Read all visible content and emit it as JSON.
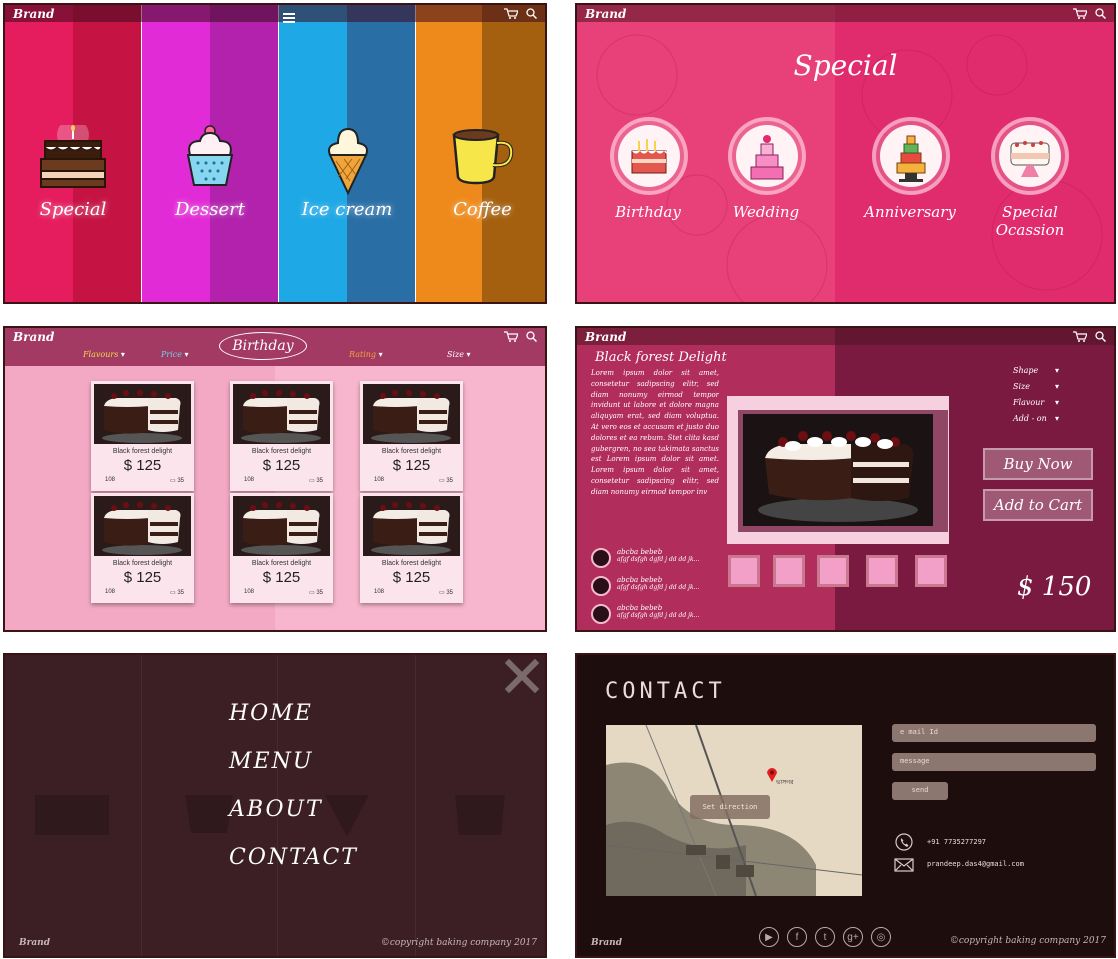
{
  "colors": {
    "special": "#d8174f",
    "dessert": "#c227bb",
    "icecream": "#2a9ad6",
    "coffee": "#e17c12",
    "special_bg": "#de3574",
    "birthday_bg": "#f3a9c4",
    "detail_bg": "#b02d5c",
    "menu_bg": "#3b1f24",
    "contact_bg": "#1e0d0d"
  },
  "brand": "Brand",
  "home": {
    "categories": [
      {
        "label": "Special",
        "icon": "cake-icon"
      },
      {
        "label": "Dessert",
        "icon": "cupcake-icon"
      },
      {
        "label": "Ice cream",
        "icon": "ice-cream-icon"
      },
      {
        "label": "Coffee",
        "icon": "coffee-cup-icon"
      }
    ]
  },
  "special": {
    "title": "Special",
    "occasions": [
      {
        "label": "Birthday",
        "icon": "birthday-cake-icon"
      },
      {
        "label": "Wedding",
        "icon": "wedding-cake-icon"
      },
      {
        "label": "Anniversary",
        "icon": "anniversary-cake-icon"
      },
      {
        "label": "Special",
        "label2": "Ocassion",
        "icon": "special-cake-icon"
      }
    ]
  },
  "birthday": {
    "title": "Birthday",
    "filters": [
      "Flavours",
      "Price",
      "Rating",
      "Size"
    ],
    "products": [
      {
        "name": "Black forest delight",
        "price": "$ 125",
        "likes": "108",
        "comments": "35"
      },
      {
        "name": "Black forest delight",
        "price": "$ 125",
        "likes": "108",
        "comments": "35"
      },
      {
        "name": "Black forest delight",
        "price": "$ 125",
        "likes": "108",
        "comments": "35"
      },
      {
        "name": "Black forest delight",
        "price": "$ 125",
        "likes": "108",
        "comments": "35"
      },
      {
        "name": "Black forest delight",
        "price": "$ 125",
        "likes": "108",
        "comments": "35"
      },
      {
        "name": "Black forest delight",
        "price": "$ 125",
        "likes": "108",
        "comments": "35"
      }
    ]
  },
  "detail": {
    "title": "Black forest Delight",
    "description": "Lorem ipsum dolor sit amet, consetetur sadipscing elitr, sed diam nonumy eirmod tempor invidunt ut labore et dolore magna aliquyam erat, sed diam voluptua. At vero eos et accusam et justo duo dolores et ea rebum. Stet clita kasd gubergren, no sea takimata sanctus est Lorem ipsum dolor sit amet. Lorem ipsum dolor sit amet, consetetur sadipscing elitr, sed diam nonumy eirmod tempor inv",
    "options": [
      "Shape",
      "Size",
      "Flavour",
      "Add - on"
    ],
    "buy_now": "Buy Now",
    "add_to_cart": "Add to Cart",
    "price": "$ 150",
    "reviews": [
      {
        "name": "abcba bebeb",
        "text": "afgf dsfgh dgfd j dd dd jk..."
      },
      {
        "name": "abcba bebeb",
        "text": "afgf dsfgh dgfd j dd dd jk..."
      },
      {
        "name": "abcba bebeb",
        "text": "afgf dsfgh dgfd j dd dd jk..."
      }
    ]
  },
  "menu": {
    "items": [
      "HOME",
      "MENU",
      "ABOUT",
      "CONTACT"
    ],
    "footer_brand": "Brand",
    "copyright": "©copyright baking company 2017"
  },
  "contact": {
    "title": "CONTACT",
    "email_placeholder": "e mail Id",
    "message_placeholder": "message",
    "send": "send",
    "phone": "+91 7735277297",
    "email": "prandeep.das4@gmail.com",
    "map_label": "Set direction",
    "map_pin_label": "ভাসগর",
    "footer_brand": "Brand",
    "copyright": "©copyright baking company 2017",
    "social": [
      "youtube-icon",
      "facebook-icon",
      "twitter-icon",
      "google-plus-icon",
      "instagram-icon"
    ]
  }
}
